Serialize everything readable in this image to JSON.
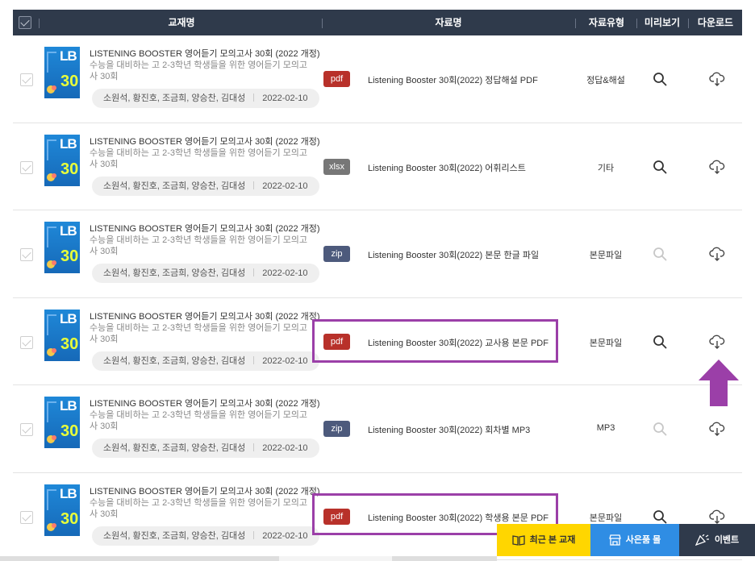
{
  "header": {
    "col_book": "교재명",
    "col_file": "자료명",
    "col_type": "자료유형",
    "col_preview": "미리보기",
    "col_download": "다운로드"
  },
  "rows": [
    {
      "book_title": "LISTENING BOOSTER 영어듣기 모의고사 30회 (2022 개정)",
      "book_desc": "수능을 대비하는 고 2-3학년 학생들을 위한 영어듣기 모의고사 30회",
      "authors": "소원석, 황진호, 조금희, 양승찬, 김대성",
      "date": "2022-02-10",
      "badge": "pdf",
      "file_name": "Listening Booster 30회(2022) 정답해설 PDF",
      "file_type": "정답&해설",
      "preview_enabled": true
    },
    {
      "book_title": "LISTENING BOOSTER 영어듣기 모의고사 30회 (2022 개정)",
      "book_desc": "수능을 대비하는 고 2-3학년 학생들을 위한 영어듣기 모의고사 30회",
      "authors": "소원석, 황진호, 조금희, 양승찬, 김대성",
      "date": "2022-02-10",
      "badge": "xlsx",
      "file_name": "Listening Booster 30회(2022) 어휘리스트",
      "file_type": "기타",
      "preview_enabled": true
    },
    {
      "book_title": "LISTENING BOOSTER 영어듣기 모의고사 30회 (2022 개정)",
      "book_desc": "수능을 대비하는 고 2-3학년 학생들을 위한 영어듣기 모의고사 30회",
      "authors": "소원석, 황진호, 조금희, 양승찬, 김대성",
      "date": "2022-02-10",
      "badge": "zip",
      "file_name": "Listening Booster 30회(2022) 본문 한글 파일",
      "file_type": "본문파일",
      "preview_enabled": false
    },
    {
      "book_title": "LISTENING BOOSTER 영어듣기 모의고사 30회 (2022 개정)",
      "book_desc": "수능을 대비하는 고 2-3학년 학생들을 위한 영어듣기 모의고사 30회",
      "authors": "소원석, 황진호, 조금희, 양승찬, 김대성",
      "date": "2022-02-10",
      "badge": "pdf",
      "file_name": "Listening Booster 30회(2022) 교사용 본문 PDF",
      "file_type": "본문파일",
      "preview_enabled": true
    },
    {
      "book_title": "LISTENING BOOSTER 영어듣기 모의고사 30회 (2022 개정)",
      "book_desc": "수능을 대비하는 고 2-3학년 학생들을 위한 영어듣기 모의고사 30회",
      "authors": "소원석, 황진호, 조금희, 양승찬, 김대성",
      "date": "2022-02-10",
      "badge": "zip",
      "file_name": "Listening Booster 30회(2022) 회차별 MP3",
      "file_type": "MP3",
      "preview_enabled": false
    },
    {
      "book_title": "LISTENING BOOSTER 영어듣기 모의고사 30회 (2022 개정)",
      "book_desc": "수능을 대비하는 고 2-3학년 학생들을 위한 영어듣기 모의고사 30회",
      "authors": "소원석, 황진호, 조금희, 양승찬, 김대성",
      "date": "2022-02-10",
      "badge": "pdf",
      "file_name": "Listening Booster 30회(2022) 학생용 본문 PDF",
      "file_type": "본문파일",
      "preview_enabled": true
    }
  ],
  "cover": {
    "letters": "LB",
    "number": "30"
  },
  "badge_colors": {
    "pdf": "#b8312a",
    "xlsx": "#777777",
    "zip": "#4d5a7c"
  },
  "float_bar": {
    "recent": "최근 본 교재",
    "mall": "사은품 몰",
    "event": "이벤트",
    "recent_color": "#ffd600",
    "mall_color": "#2f8de4",
    "event_color": "#2f3a4b"
  },
  "annotation_color": "#9b3fa8"
}
